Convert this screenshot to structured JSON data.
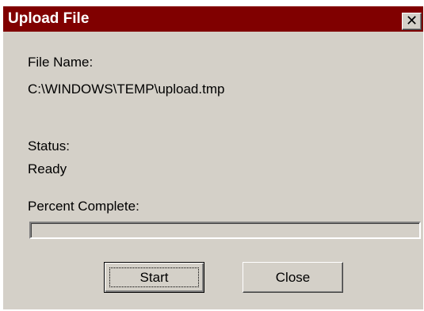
{
  "window": {
    "title": "Upload File",
    "close_glyph": "✕",
    "close_icon": "close-icon"
  },
  "file": {
    "label": "File Name:",
    "value": "C:\\WINDOWS\\TEMP\\upload.tmp"
  },
  "status": {
    "label": "Status:",
    "value": "Ready"
  },
  "progress": {
    "label": "Percent Complete:",
    "percent": 0
  },
  "buttons": {
    "start_label": "Start",
    "close_label": "Close"
  },
  "colors": {
    "titlebar": "#800000",
    "face": "#d4d0c8",
    "progress_fill": "#000080"
  }
}
